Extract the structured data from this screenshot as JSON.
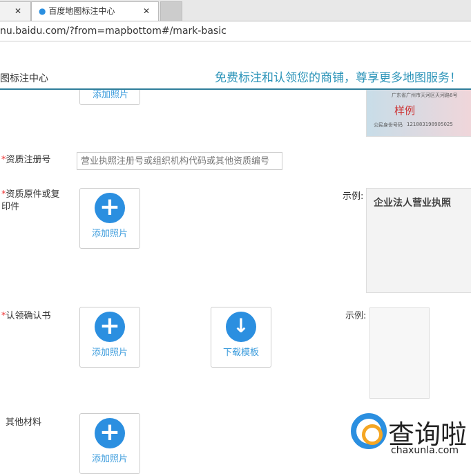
{
  "browser": {
    "tab_title": "百度地图标注中心",
    "url": "nu.baidu.com/?from=mapbottom#/mark-basic"
  },
  "header": {
    "title": "图标注中心",
    "slogan": "免费标注和认领您的商铺，尊享更多地图服务！"
  },
  "id_sample": {
    "address": "广东省广州市天河区天河路6号",
    "stamp": "样例",
    "id_label": "公民身份号码",
    "id_number": "121883198905025"
  },
  "form": {
    "reg_label": "资质注册号",
    "reg_placeholder": "营业执照注册号或组织机构代码或其他资质编号",
    "orig_label": "资质原件或复印件",
    "confirm_label": "认领确认书",
    "other_label": "其他材料",
    "add_photo": "添加照片",
    "download_template": "下载模板",
    "sample_label": "示例:",
    "license_title": "企业法人营业执照"
  },
  "watermark": {
    "name": "查询啦",
    "domain": "chaxunla.com"
  }
}
